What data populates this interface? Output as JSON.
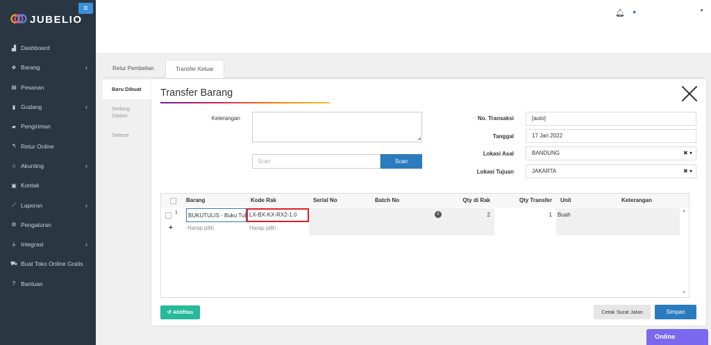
{
  "brand": {
    "name": "JUBELIO",
    "toggle_icon": "hamburger-icon"
  },
  "sidebar": {
    "items": [
      {
        "label": "Dashboard",
        "icon": "chart-area-icon",
        "has_submenu": false
      },
      {
        "label": "Barang",
        "icon": "cubes-icon",
        "has_submenu": true
      },
      {
        "label": "Pesanan",
        "icon": "inbox-icon",
        "has_submenu": false
      },
      {
        "label": "Gudang",
        "icon": "building-icon",
        "has_submenu": true
      },
      {
        "label": "Pengiriman",
        "icon": "truck-icon",
        "has_submenu": false
      },
      {
        "label": "Retur Online",
        "icon": "reply-icon",
        "has_submenu": false
      },
      {
        "label": "Akunting",
        "icon": "bank-icon",
        "has_submenu": true
      },
      {
        "label": "Kontak",
        "icon": "address-card-icon",
        "has_submenu": false
      },
      {
        "label": "Laporan",
        "icon": "line-chart-icon",
        "has_submenu": true
      },
      {
        "label": "Pengaturan",
        "icon": "gears-icon",
        "has_submenu": false
      },
      {
        "label": "Integrasi",
        "icon": "plug-icon",
        "has_submenu": true
      },
      {
        "label": "Buat Toko Online Gratis",
        "icon": "cart-icon",
        "has_submenu": false
      },
      {
        "label": "Bantuan",
        "icon": "question-circle-icon",
        "has_submenu": false
      }
    ]
  },
  "topbar": {
    "bell_icon": "bell-icon",
    "user_icon": "user-icon",
    "caret": "▾"
  },
  "page_tabs": [
    {
      "label": "Retur Pembelian",
      "active": false
    },
    {
      "label": "Transfer Keluar",
      "active": true
    }
  ],
  "vertical_tabs": [
    {
      "label": "Baru Dibuat",
      "active": true
    },
    {
      "label": "Sedang Dijalan",
      "active": false
    },
    {
      "label": "Selesai",
      "active": false
    }
  ],
  "modal": {
    "title": "Transfer Barang",
    "keterangan_label": "Keterangan",
    "keterangan_value": "",
    "scan_placeholder": "Scan",
    "scan_button": "Scan",
    "fields": {
      "no_transaksi": {
        "label": "No. Transaksi",
        "value": "[auto]"
      },
      "tanggal": {
        "label": "Tanggal",
        "value": "17 Jan 2022"
      },
      "lokasi_asal": {
        "label": "Lokasi Asal",
        "value": "BANDUNG"
      },
      "lokasi_tujuan": {
        "label": "Lokasi Tujuan",
        "value": "JAKARTA"
      }
    },
    "clear_glyph": "✖ ▾"
  },
  "grid": {
    "columns": [
      "Barang",
      "Kode Rak",
      "Serial No",
      "Batch No",
      "Qty di Rak",
      "Qty Transfer",
      "Unit",
      "Keterangan"
    ],
    "rows": [
      {
        "num": "1",
        "barang": "BUKUTULIS - Buku Tulis",
        "kode_rak": "LX-BX-KX-RX2-1.0",
        "serial_no": "",
        "batch_no": "",
        "qty_di_rak": "2",
        "qty_transfer": "1",
        "unit": "Buah",
        "keterangan": ""
      }
    ],
    "new_row": {
      "add_glyph": "+",
      "barang_placeholder": "Harap pilih",
      "kode_rak_placeholder": "Harap pilih"
    },
    "highlight_color": "#e31b23"
  },
  "buttons": {
    "aktifitas": "Aktifitas",
    "cetak": "Cetak Surat Jalan",
    "simpan": "Simpan"
  },
  "status": {
    "online": "Online"
  },
  "colors": {
    "sidebar": "#2b3643",
    "primary": "#2b7bbf",
    "success": "#26b99a",
    "online": "#7b68ee"
  }
}
